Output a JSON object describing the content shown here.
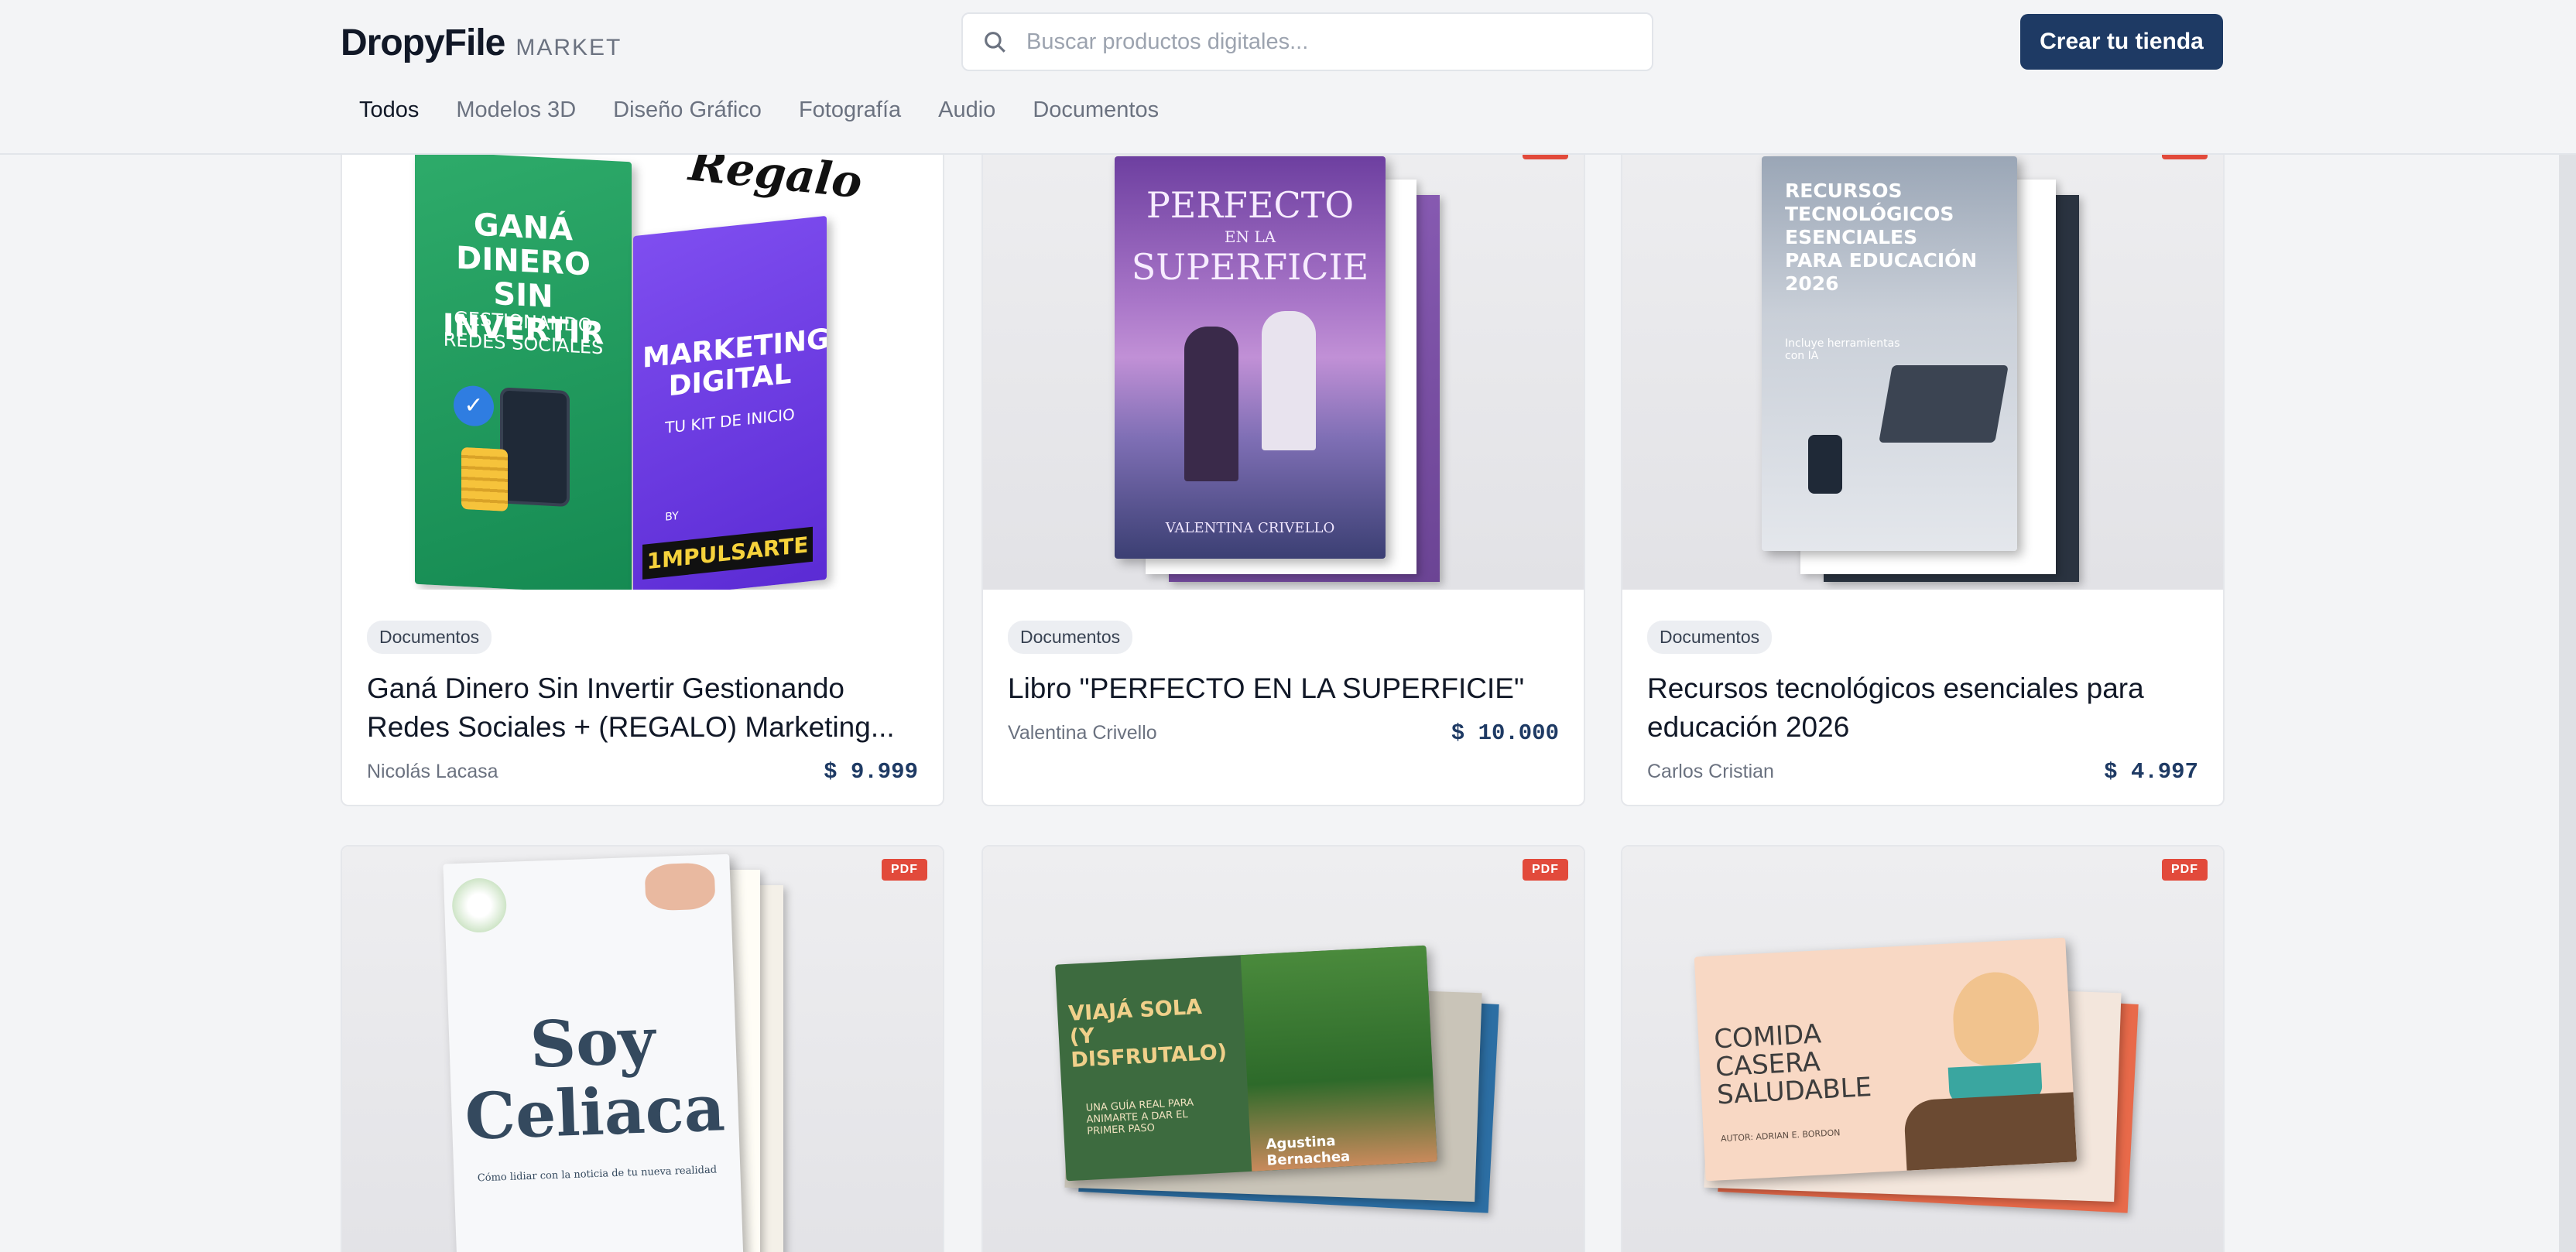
{
  "header": {
    "logo": "DropyFile",
    "logo_sub": "MARKET",
    "search_placeholder": "Buscar productos digitales...",
    "cta": "Crear tu tienda"
  },
  "tabs": [
    {
      "label": "Todos",
      "active": true
    },
    {
      "label": "Modelos 3D"
    },
    {
      "label": "Diseño Gráfico"
    },
    {
      "label": "Fotografía"
    },
    {
      "label": "Audio"
    },
    {
      "label": "Documentos"
    }
  ],
  "colors": {
    "accent": "#1e3a64",
    "pdf_badge": "#e24a3b"
  },
  "products": [
    {
      "category": "Documentos",
      "title": "Ganá Dinero Sin Invertir Gestionando Redes Sociales + (REGALO) Marketing...",
      "author": "Nicolás Lacasa",
      "price": "$ 9.999",
      "cover": {
        "main": "GANÁ DINERO SIN INVERTIR",
        "sub": "GESTIONANDO REDES SOCIALES",
        "side": "MARKETING DIGITAL",
        "side_sub": "TU KIT DE INICIO",
        "gift": "Regalo",
        "by": "BY",
        "brand": "1MPULSARTE"
      }
    },
    {
      "category": "Documentos",
      "title": "Libro \"PERFECTO EN LA SUPERFICIE\"",
      "author": "Valentina Crivello",
      "price": "$ 10.000",
      "pdf": "PDF",
      "cover": {
        "main": "PERFECTO",
        "mid": "EN LA",
        "sub": "SUPERFICIE",
        "author": "VALENTINA CRIVELLO"
      }
    },
    {
      "category": "Documentos",
      "title": "Recursos tecnológicos esenciales para educación 2026",
      "author": "Carlos Cristian",
      "price": "$ 4.997",
      "pdf": "PDF",
      "cover": {
        "main": "RECURSOS TECNOLÓGICOS ESENCIALES PARA EDUCACIÓN 2026",
        "sub": "Incluye herramientas con IA"
      }
    },
    {
      "pdf": "PDF",
      "cover": {
        "main": "Soy",
        "sub": "Celiaca",
        "caption": "Cómo lidiar con la noticia de tu nueva realidad"
      }
    },
    {
      "pdf": "PDF",
      "cover": {
        "main": "VIAJÁ SOLA (Y DISFRUTALO)",
        "sub": "UNA GUÍA REAL PARA ANIMARTE A DAR EL PRIMER PASO",
        "author": "Agustina Bernachea"
      }
    },
    {
      "pdf": "PDF",
      "cover": {
        "main": "COMIDA CASERA SALUDABLE",
        "sub": "AUTOR: ADRIAN E. BORDON"
      }
    }
  ]
}
